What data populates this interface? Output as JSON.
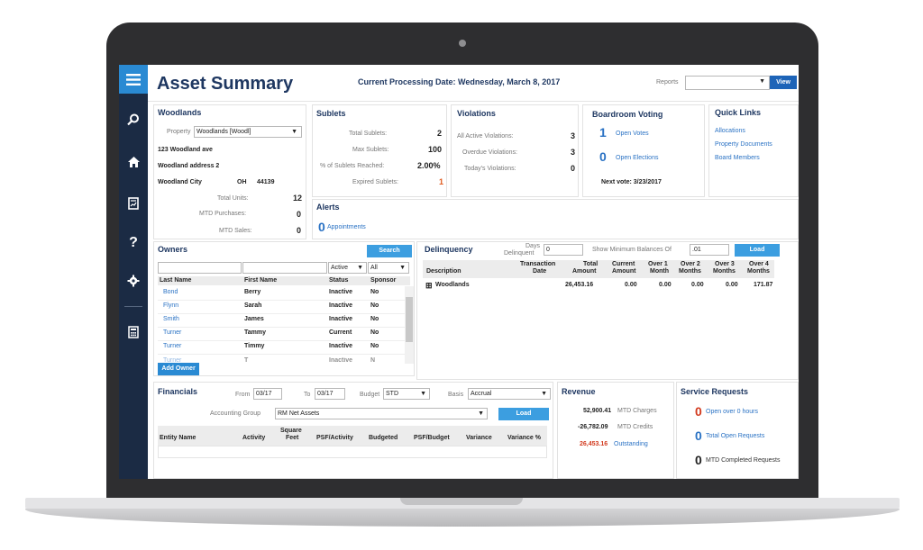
{
  "app": {
    "title": "Asset Summary",
    "processing": "Current Processing Date: Wednesday, March 8, 2017",
    "reports_label": "Reports",
    "view_label": "View",
    "select_arrow": "▼"
  },
  "sidebar": {
    "icons": [
      "menu-icon",
      "search-icon",
      "home-icon",
      "reports-icon",
      "help-icon",
      "settings-icon",
      "calculator-icon"
    ]
  },
  "woodlands": {
    "title": "Woodlands",
    "property_label": "Property",
    "property_value": "Woodlands [Woodl]",
    "address1": "123 Woodland ave",
    "address2": "Woodland address 2",
    "city": "Woodland City",
    "state": "OH",
    "zip": "44139",
    "units_label": "Total Units:",
    "units": "12",
    "purchases_label": "MTD Purchases:",
    "purchases": "0",
    "sales_label": "MTD Sales:",
    "sales": "0"
  },
  "sublets": {
    "title": "Sublets",
    "rows": [
      {
        "label": "Total Sublets:",
        "value": "2"
      },
      {
        "label": "Max Sublets:",
        "value": "100"
      },
      {
        "label": "% of Sublets Reached:",
        "value": "2.00%"
      },
      {
        "label": "Expired Sublets:",
        "value": "1"
      }
    ]
  },
  "violations": {
    "title": "Violations",
    "rows": [
      {
        "label": "All Active Violations:",
        "value": "3"
      },
      {
        "label": "Overdue Violations:",
        "value": "3"
      },
      {
        "label": "Today's Violations:",
        "value": "0"
      }
    ]
  },
  "boardroom": {
    "title": "Boardroom Voting",
    "votes_count": "1",
    "votes_label": "Open Votes",
    "elections_count": "0",
    "elections_label": "Open Elections",
    "next_vote": "Next vote: 3/23/2017"
  },
  "quicklinks": {
    "title": "Quick Links",
    "links": [
      "Allocations",
      "Property Documents",
      "Board Members"
    ]
  },
  "alerts": {
    "title": "Alerts",
    "count": "0",
    "label": "Appointments"
  },
  "owners": {
    "title": "Owners",
    "search_label": "Search",
    "status_filter": "Active",
    "sponsor_filter": "All",
    "headers": [
      "Last Name",
      "First Name",
      "Status",
      "Sponsor"
    ],
    "rows": [
      {
        "last": "Bond",
        "first": "Berry",
        "status": "Inactive",
        "sponsor": "No"
      },
      {
        "last": "Flynn",
        "first": "Sarah",
        "status": "Inactive",
        "sponsor": "No"
      },
      {
        "last": "Smith",
        "first": "James",
        "status": "Inactive",
        "sponsor": "No"
      },
      {
        "last": "Turner",
        "first": "Tammy",
        "status": "Current",
        "sponsor": "No"
      },
      {
        "last": "Turner",
        "first": "Timmy",
        "status": "Inactive",
        "sponsor": "No"
      },
      {
        "last": "Turner",
        "first": "T",
        "status": "Inactive",
        "sponsor": "N"
      }
    ],
    "add_label": "Add Owner"
  },
  "delinquency": {
    "title": "Delinquency",
    "days_label_1": "Days",
    "days_label_2": "Delinquent",
    "days_value": "0",
    "min_balance_label": "Show Minimum Balances Of",
    "min_balance_value": ".01",
    "load_label": "Load",
    "headers": [
      {
        "l1": "",
        "l2": "Description"
      },
      {
        "l1": "Transaction",
        "l2": "Date"
      },
      {
        "l1": "Total",
        "l2": "Amount"
      },
      {
        "l1": "Current",
        "l2": "Amount"
      },
      {
        "l1": "Over 1",
        "l2": "Month"
      },
      {
        "l1": "Over 2",
        "l2": "Months"
      },
      {
        "l1": "Over 3",
        "l2": "Months"
      },
      {
        "l1": "Over 4",
        "l2": "Months"
      }
    ],
    "row": {
      "expand": "⊞",
      "description": "Woodlands",
      "date": "",
      "total": "26,453.16",
      "current": "0.00",
      "over1": "0.00",
      "over2": "0.00",
      "over3": "0.00",
      "over4": "171.87"
    }
  },
  "financials": {
    "title": "Financials",
    "from_label": "From",
    "from_value": "03/17",
    "to_label": "To",
    "to_value": "03/17",
    "budget_label": "Budget",
    "budget_value": "STD",
    "basis_label": "Basis",
    "basis_value": "Accrual",
    "group_label": "Accounting Group",
    "group_value": "RM Net Assets",
    "load_label": "Load",
    "headers": [
      {
        "l1": "",
        "l2": "Entity Name"
      },
      {
        "l1": "",
        "l2": "Activity"
      },
      {
        "l1": "Square",
        "l2": "Feet"
      },
      {
        "l1": "",
        "l2": "PSF/Activity"
      },
      {
        "l1": "",
        "l2": "Budgeted"
      },
      {
        "l1": "",
        "l2": "PSF/Budget"
      },
      {
        "l1": "",
        "l2": "Variance"
      },
      {
        "l1": "",
        "l2": "Variance %"
      }
    ]
  },
  "revenue": {
    "title": "Revenue",
    "charges_value": "52,900.41",
    "charges_label": "MTD Charges",
    "credits_value": "-26,782.09",
    "credits_label": "MTD Credits",
    "outstanding_value": "26,453.16",
    "outstanding_label": "Outstanding"
  },
  "service": {
    "title": "Service Requests",
    "open_over_count": "0",
    "open_over_label": "Open over 0 hours",
    "total_open_count": "0",
    "total_open_label": "Total Open Requests",
    "completed_count": "0",
    "completed_label": "MTD Completed Requests"
  },
  "colors": {
    "navy": "#1e3761",
    "sidebar": "#1b2b44",
    "accent": "#3c9ee0",
    "link": "#2a72c4",
    "alert": "#d23a1e"
  }
}
